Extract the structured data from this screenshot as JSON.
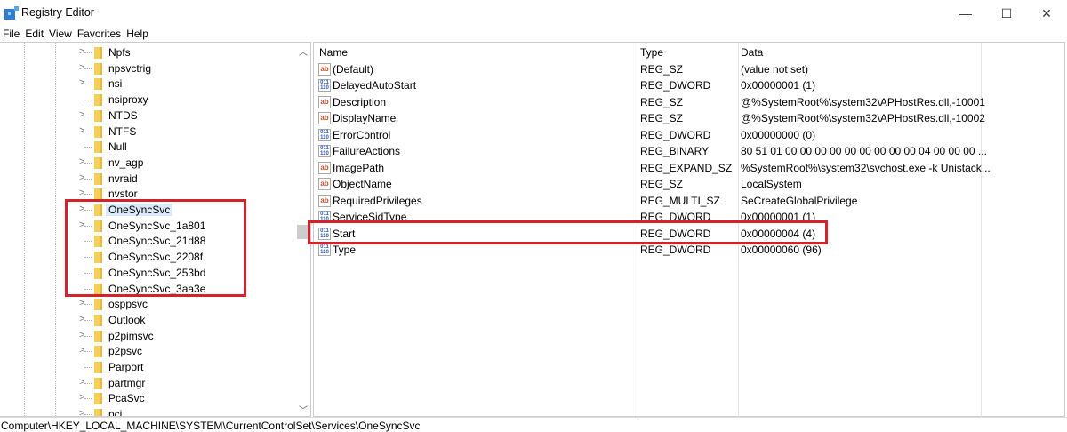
{
  "window": {
    "title": "Registry Editor",
    "minimize": "—",
    "maximize": "☐",
    "close": "✕"
  },
  "menu": [
    "File",
    "Edit",
    "View",
    "Favorites",
    "Help"
  ],
  "tree": {
    "items": [
      {
        "label": "Npfs",
        "expandable": true
      },
      {
        "label": "npsvctrig",
        "expandable": true
      },
      {
        "label": "nsi",
        "expandable": true
      },
      {
        "label": "nsiproxy",
        "expandable": false
      },
      {
        "label": "NTDS",
        "expandable": true
      },
      {
        "label": "NTFS",
        "expandable": true
      },
      {
        "label": "Null",
        "expandable": false
      },
      {
        "label": "nv_agp",
        "expandable": true
      },
      {
        "label": "nvraid",
        "expandable": true
      },
      {
        "label": "nvstor",
        "expandable": true
      },
      {
        "label": "OneSyncSvc",
        "expandable": true,
        "selected": true
      },
      {
        "label": "OneSyncSvc_1a801",
        "expandable": true
      },
      {
        "label": "OneSyncSvc_21d88",
        "expandable": false
      },
      {
        "label": "OneSyncSvc_2208f",
        "expandable": false
      },
      {
        "label": "OneSyncSvc_253bd",
        "expandable": false
      },
      {
        "label": "OneSyncSvc_3aa3e",
        "expandable": false
      },
      {
        "label": "osppsvc",
        "expandable": true
      },
      {
        "label": "Outlook",
        "expandable": true
      },
      {
        "label": "p2pimsvc",
        "expandable": true
      },
      {
        "label": "p2psvc",
        "expandable": true
      },
      {
        "label": "Parport",
        "expandable": false
      },
      {
        "label": "partmgr",
        "expandable": true
      },
      {
        "label": "PcaSvc",
        "expandable": true
      },
      {
        "label": "pci",
        "expandable": true
      }
    ]
  },
  "values": {
    "headers": {
      "name": "Name",
      "type": "Type",
      "data": "Data"
    },
    "rows": [
      {
        "icon": "string",
        "name": "(Default)",
        "type": "REG_SZ",
        "data": "(value not set)"
      },
      {
        "icon": "binary",
        "name": "DelayedAutoStart",
        "type": "REG_DWORD",
        "data": "0x00000001 (1)"
      },
      {
        "icon": "string",
        "name": "Description",
        "type": "REG_SZ",
        "data": "@%SystemRoot%\\system32\\APHostRes.dll,-10001"
      },
      {
        "icon": "string",
        "name": "DisplayName",
        "type": "REG_SZ",
        "data": "@%SystemRoot%\\system32\\APHostRes.dll,-10002"
      },
      {
        "icon": "binary",
        "name": "ErrorControl",
        "type": "REG_DWORD",
        "data": "0x00000000 (0)"
      },
      {
        "icon": "binary",
        "name": "FailureActions",
        "type": "REG_BINARY",
        "data": "80 51 01 00 00 00 00 00 00 00 00 00 04 00 00 00 ..."
      },
      {
        "icon": "string",
        "name": "ImagePath",
        "type": "REG_EXPAND_SZ",
        "data": "%SystemRoot%\\system32\\svchost.exe -k Unistack..."
      },
      {
        "icon": "string",
        "name": "ObjectName",
        "type": "REG_SZ",
        "data": "LocalSystem"
      },
      {
        "icon": "string",
        "name": "RequiredPrivileges",
        "type": "REG_MULTI_SZ",
        "data": "SeCreateGlobalPrivilege"
      },
      {
        "icon": "binary",
        "name": "ServiceSidType",
        "type": "REG_DWORD",
        "data": "0x00000001 (1)"
      },
      {
        "icon": "binary",
        "name": "Start",
        "type": "REG_DWORD",
        "data": "0x00000004 (4)"
      },
      {
        "icon": "binary",
        "name": "Type",
        "type": "REG_DWORD",
        "data": "0x00000060 (96)"
      }
    ]
  },
  "status": {
    "path": "Computer\\HKEY_LOCAL_MACHINE\\SYSTEM\\CurrentControlSet\\Services\\OneSyncSvc"
  },
  "colors": {
    "highlight": "#d3222a",
    "selection": "#d9ebfb"
  }
}
